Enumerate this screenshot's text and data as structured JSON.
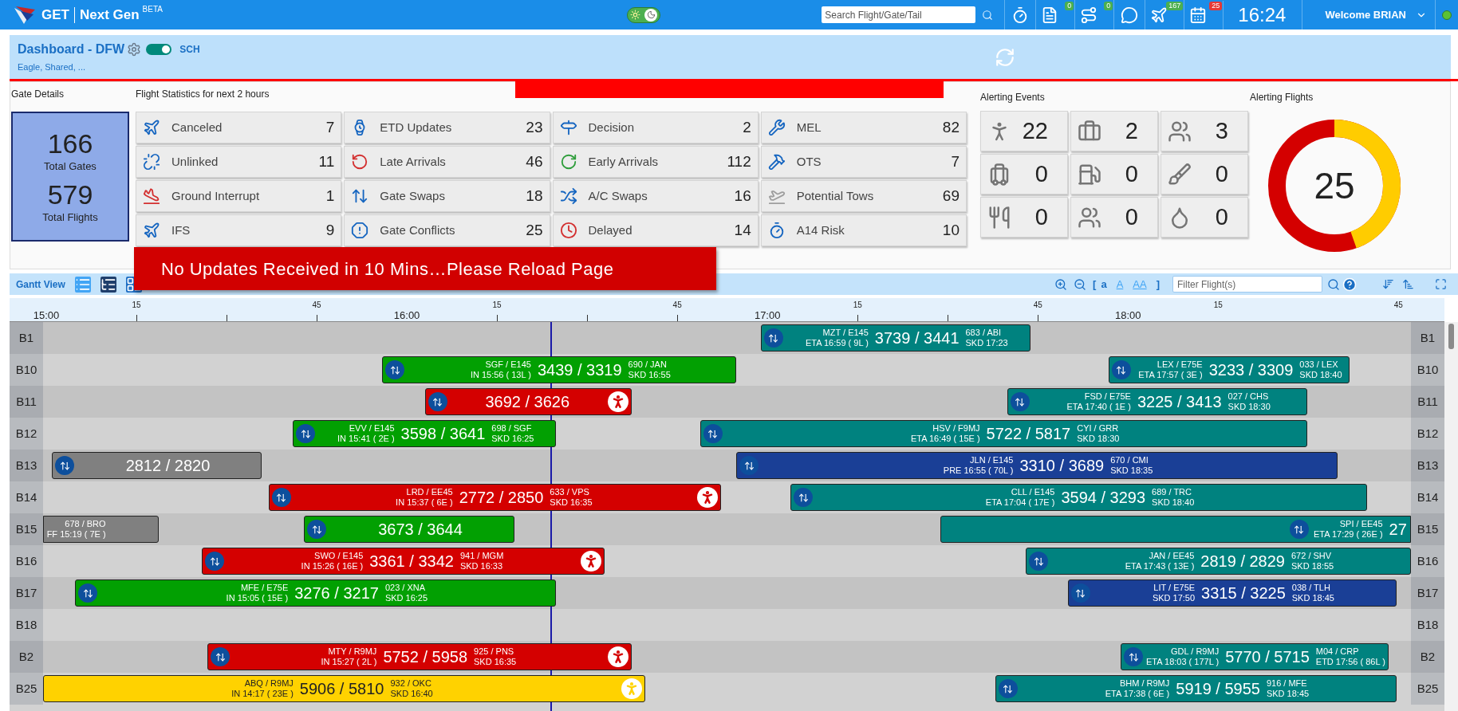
{
  "top_bar": {
    "logo": {
      "name": "GET",
      "product": "Next Gen",
      "tag": "BETA"
    },
    "theme_toggle": {
      "on": true
    },
    "search": {
      "placeholder": "Search Flight/Gate/Tail"
    },
    "icons": [
      {
        "kind": "plain"
      },
      {
        "kind": "badged",
        "count": "0",
        "color": "#4caf50"
      },
      {
        "kind": "badged",
        "count": "0",
        "color": "#4caf50"
      },
      {
        "kind": "plain"
      },
      {
        "kind": "badged",
        "count": "167",
        "color": "#4caf50"
      },
      {
        "kind": "badged",
        "count": "25",
        "color": "#e53935"
      }
    ],
    "clock": "16:24",
    "user": "Welcome BRIAN",
    "status": {
      "color": "#5cc234"
    }
  },
  "header": {
    "title": "Dashboard - DFW",
    "toggle": {
      "on": true
    },
    "mode": "SCH",
    "subtitle": "Eagle, Shared, ..."
  },
  "gate_details": {
    "title": "Gate Details",
    "stats": [
      {
        "value": "166",
        "label": "Total Gates"
      },
      {
        "value": "579",
        "label": "Total Flights"
      }
    ]
  },
  "flight_statistics": {
    "title": "Flight Statistics for next 2 hours",
    "items": [
      {
        "label": "Canceled",
        "value": "7"
      },
      {
        "label": "ETD Updates",
        "value": "23"
      },
      {
        "label": "Decision",
        "value": "2"
      },
      {
        "label": "MEL",
        "value": "82"
      },
      {
        "label": "Unlinked",
        "value": "11"
      },
      {
        "label": "Late Arrivals",
        "value": "46"
      },
      {
        "label": "Early Arrivals",
        "value": "112"
      },
      {
        "label": "OTS",
        "value": "7"
      },
      {
        "label": "Ground Interrupt",
        "value": "1"
      },
      {
        "label": "Gate Swaps",
        "value": "18"
      },
      {
        "label": "A/C Swaps",
        "value": "16"
      },
      {
        "label": "Potential Tows",
        "value": "69"
      },
      {
        "label": "IFS",
        "value": "9"
      },
      {
        "label": "Gate Conflicts",
        "value": "25"
      },
      {
        "label": "Delayed",
        "value": "14"
      },
      {
        "label": "A14 Risk",
        "value": "10"
      }
    ]
  },
  "alerting_events": {
    "title": "Alerting Events",
    "items": [
      {
        "value": "22"
      },
      {
        "value": "2"
      },
      {
        "value": "3"
      },
      {
        "value": "0"
      },
      {
        "value": "0"
      },
      {
        "value": "0"
      },
      {
        "value": "0"
      },
      {
        "value": "0"
      },
      {
        "value": "0"
      }
    ]
  },
  "alerting_flights": {
    "title": "Alerting Flights",
    "total": "25"
  },
  "warning_banner": {
    "text": "No Updates Received in 10 Mins…Please Reload Page"
  },
  "gantt": {
    "title": "Gantt View",
    "font_sizes": [
      {
        "label": "a",
        "selected": true
      },
      {
        "label": "A",
        "selected": false
      },
      {
        "label": "AA",
        "selected": false
      }
    ],
    "bracket_open": "[",
    "bracket_close": "]",
    "filter": {
      "placeholder": "Filter Flight(s)"
    },
    "timeline": [
      "15:00",
      "15",
      "45",
      "16:00",
      "15",
      "45",
      "17:00",
      "15",
      "45",
      "18:00",
      "15",
      "45"
    ],
    "rows": [
      {
        "gate": "B1",
        "gate_right": "B1",
        "bars": [
          {
            "color": "#00827f",
            "swap": true,
            "alert": false,
            "left_lines": [
              "MZT / E145",
              "ETA 16:59 ( 9L )"
            ],
            "number": "3739 / 3441",
            "right_lines": [
              "683 / ABI",
              "SKD 17:23"
            ]
          }
        ]
      },
      {
        "gate": "B10",
        "gate_right": "B10",
        "bars": [
          {
            "color": "#02a002",
            "swap": true,
            "alert": false,
            "left_lines": [
              "SGF / E145",
              "IN 15:56 ( 13L )"
            ],
            "number": "3439 / 3319",
            "right_lines": [
              "690 / JAN",
              "SKD 16:55"
            ]
          },
          {
            "color": "#00827f",
            "swap": true,
            "alert": false,
            "left_lines": [
              "LEX / E75E",
              "ETA 17:57 ( 3E )"
            ],
            "number": "3233 / 3309",
            "right_lines": [
              "033 / LEX",
              "SKD 18:40"
            ]
          }
        ]
      },
      {
        "gate": "B11",
        "gate_right": "B11",
        "bars": [
          {
            "color": "#d40000",
            "swap": true,
            "alert": true,
            "number": "3692 / 3626"
          },
          {
            "color": "#00827f",
            "swap": true,
            "alert": false,
            "left_lines": [
              "FSD / E75E",
              "ETA 17:40 ( 1E )"
            ],
            "number": "3225 / 3413",
            "right_lines": [
              "027 / CHS",
              "SKD 18:30"
            ]
          }
        ]
      },
      {
        "gate": "B12",
        "gate_right": "B12",
        "bars": [
          {
            "color": "#02a002",
            "swap": true,
            "alert": false,
            "left_lines": [
              "EVV / E145",
              "IN 15:41 ( 2E )"
            ],
            "number": "3598 / 3641",
            "right_lines": [
              "698 / SGF",
              "SKD 16:25"
            ]
          },
          {
            "color": "#00827f",
            "swap": true,
            "alert": false,
            "left_lines": [
              "HSV / F9MJ",
              "ETA 16:49 ( 15E )"
            ],
            "number": "5722 / 5817",
            "right_lines": [
              "CYI / GRR",
              "SKD 18:30"
            ]
          }
        ]
      },
      {
        "gate": "B13",
        "gate_right": "B13",
        "bars": [
          {
            "color": "#808080",
            "swap": true,
            "alert": false,
            "number": "2812 / 2820"
          },
          {
            "color": "#1a3f96",
            "swap": true,
            "alert": false,
            "left_lines": [
              "JLN / E145",
              "PRE 16:55 ( 70L )"
            ],
            "number": "3310 / 3689",
            "right_lines": [
              "670 / CMI",
              "SKD 18:35"
            ]
          }
        ]
      },
      {
        "gate": "B14",
        "gate_right": "B14",
        "bars": [
          {
            "color": "#d40000",
            "swap": true,
            "alert": true,
            "left_lines": [
              "LRD / EE45",
              "IN 15:37 ( 6E )"
            ],
            "number": "2772 / 2850",
            "right_lines": [
              "633 / VPS",
              "SKD 16:35"
            ]
          },
          {
            "color": "#00827f",
            "swap": true,
            "alert": false,
            "left_lines": [
              "CLL / E145",
              "ETA 17:04 ( 17E )"
            ],
            "number": "3594 / 3293",
            "right_lines": [
              "689 / TRC",
              "SKD 18:40"
            ]
          }
        ]
      },
      {
        "gate": "B15",
        "gate_right": "B15",
        "bars": [
          {
            "color": "#808080",
            "swap": false,
            "alert": false,
            "left_lines": [
              "678 / BRO",
              "FF 15:19 ( 7E )"
            ]
          },
          {
            "color": "#02a002",
            "swap": true,
            "alert": false,
            "number": "3673 / 3644"
          },
          {
            "color": "#00827f",
            "swap": true,
            "alert": false,
            "left_lines": [
              "SPI / EE45",
              "ETA 17:29 ( 26E )"
            ],
            "number": "27"
          }
        ]
      },
      {
        "gate": "B16",
        "gate_right": "B16",
        "bars": [
          {
            "color": "#d40000",
            "swap": true,
            "alert": true,
            "left_lines": [
              "SWO / E145",
              "IN 15:26 ( 16E )"
            ],
            "number": "3361 / 3342",
            "right_lines": [
              "941 / MGM",
              "SKD 16:33"
            ]
          },
          {
            "color": "#00827f",
            "swap": true,
            "alert": false,
            "left_lines": [
              "JAN / EE45",
              "ETA 17:43 ( 13E )"
            ],
            "number": "2819 / 2829",
            "right_lines": [
              "672 / SHV",
              "SKD 18:55"
            ]
          }
        ]
      },
      {
        "gate": "B17",
        "gate_right": "B17",
        "bars": [
          {
            "color": "#02a002",
            "swap": true,
            "alert": false,
            "left_lines": [
              "MFE / E75E",
              "IN 15:05 ( 15E )"
            ],
            "number": "3276 / 3217",
            "right_lines": [
              "023 / XNA",
              "SKD 16:25"
            ]
          },
          {
            "color": "#1a3f96",
            "swap": true,
            "alert": false,
            "left_lines": [
              "LIT / E75E",
              "SKD 17:50"
            ],
            "number": "3315 / 3225",
            "right_lines": [
              "038 / TLH",
              "SKD 18:45"
            ]
          }
        ]
      },
      {
        "gate": "B18",
        "gate_right": "B18",
        "bars": []
      },
      {
        "gate": "B2",
        "gate_right": "B2",
        "bars": [
          {
            "color": "#d40000",
            "swap": true,
            "alert": true,
            "left_lines": [
              "MTY / R9MJ",
              "IN 15:27 ( 2L )"
            ],
            "number": "5752 / 5958",
            "right_lines": [
              "925 / PNS",
              "SKD 16:35"
            ]
          },
          {
            "color": "#00827f",
            "swap": true,
            "alert": false,
            "left_lines": [
              "GDL / R9MJ",
              "ETA 18:03 ( 177L )"
            ],
            "number": "5770 / 5715",
            "right_lines": [
              "M04 / CRP",
              "ETD 17:56 ( 86L )"
            ]
          }
        ]
      },
      {
        "gate": "B25",
        "gate_right": "B25",
        "bars": [
          {
            "color": "#ffd200",
            "swap": false,
            "alert": true,
            "left_lines": [
              "ABQ / R9MJ",
              "IN 14:17 ( 23E )"
            ],
            "number": "5906 / 5810",
            "right_lines": [
              "932 / OKC",
              "SKD 16:40"
            ]
          },
          {
            "color": "#00827f",
            "swap": true,
            "alert": false,
            "left_lines": [
              "BHM / R9MJ",
              "ETA 17:38 ( 6E )"
            ],
            "number": "5919 / 5955",
            "right_lines": [
              "916 / MFE",
              "SKD 18:45"
            ]
          }
        ]
      }
    ]
  }
}
